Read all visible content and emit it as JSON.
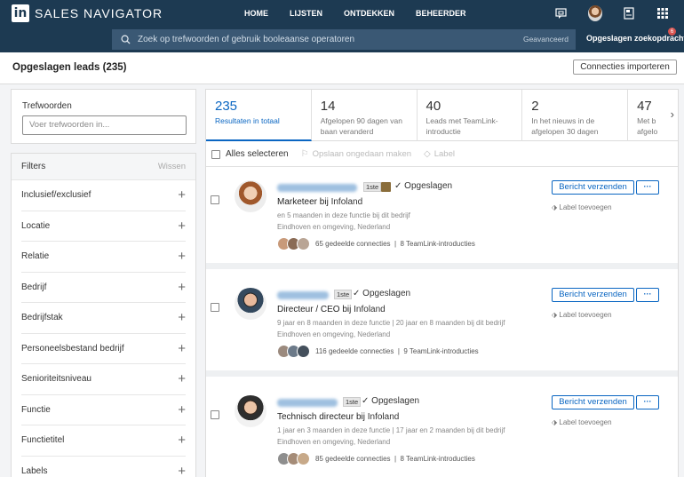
{
  "brand": {
    "mark": "in",
    "name": "SALES NAVIGATOR"
  },
  "nav": [
    "HOME",
    "LIJSTEN",
    "ONTDEKKEN",
    "BEHEERDER"
  ],
  "nav_icons": [
    "message-icon",
    "profile-avatar",
    "admin-icon",
    "apps-grid-icon"
  ],
  "search": {
    "placeholder": "Zoek op trefwoorden of gebruik booleaanse operatoren",
    "advanced": "Geavanceerd",
    "saved_searches": "Opgeslagen zoekopdrachte",
    "saved_badge": "6"
  },
  "header": {
    "title": "Opgeslagen leads (235)",
    "import_label": "Connecties importeren"
  },
  "sidebar": {
    "keywords_label": "Trefwoorden",
    "keywords_placeholder": "Voer trefwoorden in...",
    "filters_title": "Filters",
    "clear_label": "Wissen",
    "filters": [
      "Inclusief/exclusief",
      "Locatie",
      "Relatie",
      "Bedrijf",
      "Bedrijfstak",
      "Personeelsbestand bedrijf",
      "Senioriteitsniveau",
      "Functie",
      "Functietitel",
      "Labels"
    ]
  },
  "stats": [
    {
      "num": "235",
      "label": "Resultaten in totaal"
    },
    {
      "num": "14",
      "label": "Afgelopen 90 dagen van baan veranderd"
    },
    {
      "num": "40",
      "label": "Leads met TeamLink-introductie"
    },
    {
      "num": "2",
      "label": "In het nieuws in de afgelopen 30 dagen"
    },
    {
      "num": "47",
      "label": "Met b afgelo"
    }
  ],
  "selection": {
    "select_all": "Alles selecteren",
    "save": "Opslaan ongedaan maken",
    "label": "Label"
  },
  "leads": [
    {
      "degree": "1ste",
      "saved": "Opgeslagen",
      "title": "Marketeer",
      "at": "bij",
      "company": "Infoland",
      "tenure": "en 5 maanden in deze functie bij dit bedrijf",
      "location": "Eindhoven en omgeving, Nederland",
      "shared": "65 gedeelde connecties",
      "teamlink": "8 TeamLink-introducties"
    },
    {
      "degree": "1ste",
      "saved": "Opgeslagen",
      "title": "Directeur / CEO",
      "at": "bij",
      "company": "Infoland",
      "tenure": "9 jaar en 8 maanden in deze functie | 20 jaar en 8 maanden bij dit bedrijf",
      "location": "Eindhoven en omgeving, Nederland",
      "shared": "116 gedeelde connecties",
      "teamlink": "9 TeamLink-introducties"
    },
    {
      "degree": "1ste",
      "saved": "Opgeslagen",
      "title": "Technisch directeur",
      "at": "bij",
      "company": "Infoland",
      "tenure": "1 jaar en 3 maanden in deze functie | 17 jaar en 2 maanden bij dit bedrijf",
      "location": "Eindhoven en omgeving, Nederland",
      "shared": "85 gedeelde connecties",
      "teamlink": "8 TeamLink-introducties"
    }
  ],
  "actions": {
    "message": "Bericht verzenden",
    "more": "···",
    "add_label": "Label toevoegen"
  }
}
